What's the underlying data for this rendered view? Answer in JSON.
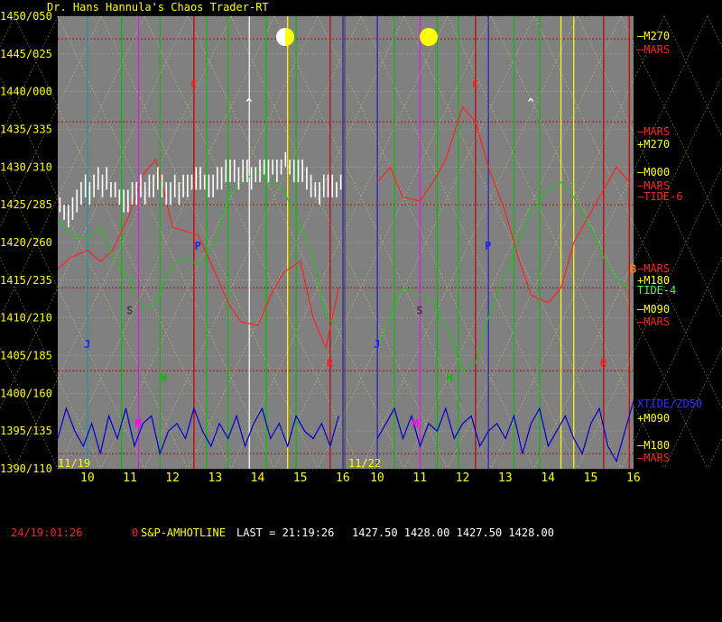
{
  "window": {
    "title": "Dr. Hans Hannula's Chaos Trader-RT"
  },
  "chart_data": {
    "type": "line",
    "price_axis": {
      "labels": [
        "1450/050",
        "1445/025",
        "1440/000",
        "1435/335",
        "1430/310",
        "1425/285",
        "1420/260",
        "1415/235",
        "1410/210",
        "1405/185",
        "1400/160",
        "1395/135",
        "1390/110"
      ],
      "ylim": [
        1390,
        1450
      ]
    },
    "time_axis": {
      "hour_labels": [
        "10",
        "11",
        "12",
        "13",
        "14",
        "15",
        "16",
        "10",
        "11",
        "12",
        "13",
        "14",
        "15",
        "16"
      ],
      "date_labels": [
        "11/19",
        "11/22"
      ]
    },
    "right_labels": [
      {
        "text": "—M270",
        "color": "#ffff00"
      },
      {
        "text": "—MARS",
        "color": "#ff2020"
      },
      {
        "text": "—MARS",
        "color": "#ff2020"
      },
      {
        "text": "+M270",
        "color": "#ffff00"
      },
      {
        "text": "—M000",
        "color": "#ffff00"
      },
      {
        "text": "—MARS",
        "color": "#ff2020"
      },
      {
        "text": "—TIDE-6",
        "color": "#ff2020"
      },
      {
        "text": "—MARS",
        "color": "#ff2020"
      },
      {
        "text": "+M180",
        "color": "#ffff00"
      },
      {
        "text": "TIDE-4",
        "color": "#40ff40"
      },
      {
        "text": "—M090",
        "color": "#ffff00"
      },
      {
        "text": "—MARS",
        "color": "#ff2020"
      },
      {
        "text": "XTIDE/ZD50",
        "color": "#3030ff"
      },
      {
        "text": "+M090",
        "color": "#ffff00"
      },
      {
        "text": "—M180",
        "color": "#ffff00"
      },
      {
        "text": "—MARS",
        "color": "#ff2020"
      }
    ],
    "planet_markers": [
      {
        "text": "C",
        "color": "#ff2020",
        "day": 1
      },
      {
        "text": "C",
        "color": "#ff2020",
        "day": 2
      },
      {
        "text": "P",
        "color": "#2020ff",
        "day": 1
      },
      {
        "text": "P",
        "color": "#2020ff",
        "day": 2
      },
      {
        "text": "S",
        "color": "#404040",
        "day": 1
      },
      {
        "text": "S",
        "color": "#404040",
        "day": 2
      },
      {
        "text": "J",
        "color": "#2020ff",
        "day": 1
      },
      {
        "text": "J",
        "color": "#2020ff",
        "day": 2
      },
      {
        "text": "R",
        "color": "#ff2020",
        "day": 1
      },
      {
        "text": "R",
        "color": "#ff2020",
        "day": 2
      },
      {
        "text": "H",
        "color": "#00c000",
        "day": 1
      },
      {
        "text": "H",
        "color": "#00c000",
        "day": 2
      },
      {
        "text": "M",
        "color": "#ff00ff",
        "day": 1
      },
      {
        "text": "M",
        "color": "#ff00ff",
        "day": 2
      },
      {
        "text": "^",
        "color": "#ffffff",
        "day": 1
      },
      {
        "text": "^",
        "color": "#ffffff",
        "day": 2
      },
      {
        "text": "B",
        "color": "#ff8000",
        "day": 2
      }
    ],
    "moon_icons": [
      "half-moon",
      "full-moon"
    ],
    "series": [
      {
        "name": "TIDE-6",
        "color": "#ff2020",
        "x": [
          9.3,
          9.6,
          10.0,
          10.3,
          10.6,
          11.0,
          11.3,
          11.6,
          12.0,
          12.3,
          12.6,
          13.0,
          13.3,
          13.6,
          14.0,
          14.3,
          14.6,
          15.0,
          15.3,
          15.6,
          15.9,
          10.0,
          10.3,
          10.6,
          11.0,
          11.3,
          11.6,
          12.0,
          12.3,
          12.6,
          13.0,
          13.3,
          13.6,
          14.0,
          14.3,
          14.6,
          15.0,
          15.3,
          15.6,
          15.9
        ],
        "y": [
          1416.5,
          1418,
          1419,
          1417.5,
          1419,
          1424,
          1429,
          1431,
          1422,
          1421.5,
          1421,
          1416,
          1412,
          1409.5,
          1409,
          1413,
          1416,
          1417.5,
          1410,
          1406,
          1414,
          1428,
          1430,
          1426,
          1425.5,
          1428,
          1431,
          1438,
          1436,
          1430,
          1424,
          1418,
          1413,
          1412,
          1414,
          1420,
          1424,
          1427,
          1430,
          1428
        ]
      },
      {
        "name": "TIDE-4",
        "color": "#20c020",
        "x": [
          9.3,
          9.6,
          10.0,
          10.3,
          10.6,
          11.0,
          11.3,
          11.6,
          12.0,
          12.3,
          12.6,
          13.0,
          13.3,
          13.6,
          14.0,
          14.3,
          14.6,
          15.0,
          15.3,
          15.6,
          15.9,
          10.0,
          10.3,
          10.6,
          11.0,
          11.3,
          11.6,
          12.0,
          12.3,
          12.6,
          13.0,
          13.3,
          13.6,
          14.0,
          14.3,
          14.6,
          15.0,
          15.3,
          15.6,
          15.9
        ],
        "y": [
          1423,
          1421,
          1420.5,
          1422,
          1418,
          1415,
          1411,
          1412,
          1417,
          1418,
          1417,
          1420,
          1426,
          1428,
          1429.5,
          1428,
          1427,
          1422,
          1418,
          1410,
          1409,
          1406,
          1410,
          1414,
          1413,
          1412,
          1409,
          1403,
          1404,
          1410,
          1416,
          1420,
          1424,
          1427,
          1428,
          1426,
          1422,
          1418,
          1415,
          1414
        ]
      },
      {
        "name": "XTIDE/ZD50",
        "color": "#0000d0",
        "x": [
          9.3,
          9.5,
          9.7,
          9.9,
          10.1,
          10.3,
          10.5,
          10.7,
          10.9,
          11.1,
          11.3,
          11.5,
          11.7,
          11.9,
          12.1,
          12.3,
          12.5,
          12.7,
          12.9,
          13.1,
          13.3,
          13.5,
          13.7,
          13.9,
          14.1,
          14.3,
          14.5,
          14.7,
          14.9,
          15.1,
          15.3,
          15.5,
          15.7,
          15.9,
          10.0,
          10.2,
          10.4,
          10.6,
          10.8,
          11.0,
          11.2,
          11.4,
          11.6,
          11.8,
          12.0,
          12.2,
          12.4,
          12.6,
          12.8,
          13.0,
          13.2,
          13.4,
          13.6,
          13.8,
          14.0,
          14.2,
          14.4,
          14.6,
          14.8,
          15.0,
          15.2,
          15.4,
          15.6,
          15.8,
          16.0
        ],
        "y": [
          1394,
          1398,
          1395,
          1393,
          1396,
          1392,
          1397,
          1394,
          1398,
          1393,
          1396,
          1397,
          1392,
          1395,
          1396,
          1394,
          1398,
          1395,
          1393,
          1396,
          1394,
          1397,
          1393,
          1396,
          1398,
          1394,
          1396,
          1393,
          1397,
          1395,
          1394,
          1396,
          1393,
          1397,
          1394,
          1396,
          1398,
          1394,
          1397,
          1393,
          1396,
          1395,
          1398,
          1394,
          1396,
          1397,
          1393,
          1395,
          1396,
          1394,
          1397,
          1392,
          1396,
          1398,
          1393,
          1395,
          1397,
          1394,
          1392,
          1396,
          1398,
          1393,
          1391,
          1395,
          1399
        ]
      }
    ],
    "price_bars": {
      "color": "#ffffff",
      "x": [
        9.35,
        9.45,
        9.55,
        9.65,
        9.75,
        9.85,
        9.95,
        10.05,
        10.15,
        10.25,
        10.35,
        10.45,
        10.55,
        10.65,
        10.75,
        10.85,
        10.95,
        11.05,
        11.15,
        11.25,
        11.35,
        11.45,
        11.55,
        11.65,
        11.75,
        11.85,
        11.95,
        12.05,
        12.15,
        12.25,
        12.35,
        12.45,
        12.55,
        12.65,
        12.75,
        12.85,
        12.95,
        13.05,
        13.15,
        13.25,
        13.35,
        13.45,
        13.55,
        13.65,
        13.75,
        13.85,
        13.95,
        14.05,
        14.15,
        14.25,
        14.35,
        14.45,
        14.55,
        14.65,
        14.75,
        14.85,
        14.95,
        15.05,
        15.15,
        15.25,
        15.35,
        15.45,
        15.55,
        15.65,
        15.75,
        15.85,
        15.95
      ],
      "low": [
        1424,
        1423,
        1422,
        1423,
        1424,
        1425,
        1426,
        1425,
        1426,
        1427,
        1426,
        1427,
        1426,
        1426,
        1425,
        1424,
        1424,
        1425,
        1425,
        1426,
        1425,
        1426,
        1426,
        1427,
        1426,
        1425,
        1425,
        1426,
        1425,
        1426,
        1426,
        1427,
        1427,
        1427,
        1427,
        1426,
        1426,
        1427,
        1427,
        1428,
        1428,
        1428,
        1427,
        1428,
        1428,
        1427,
        1428,
        1428,
        1429,
        1428,
        1429,
        1428,
        1429,
        1430,
        1429,
        1428,
        1428,
        1428,
        1427,
        1426,
        1426,
        1425,
        1426,
        1426,
        1426,
        1426,
        1427
      ],
      "high": [
        1426,
        1425,
        1425,
        1426,
        1427,
        1428,
        1429,
        1428,
        1429,
        1430,
        1429,
        1430,
        1428,
        1428,
        1427,
        1427,
        1427,
        1428,
        1428,
        1429,
        1428,
        1429,
        1429,
        1430,
        1429,
        1428,
        1428,
        1429,
        1428,
        1429,
        1429,
        1429,
        1430,
        1430,
        1429,
        1429,
        1429,
        1430,
        1430,
        1431,
        1431,
        1431,
        1430,
        1431,
        1431,
        1430,
        1430,
        1431,
        1431,
        1431,
        1431,
        1431,
        1431,
        1432,
        1431,
        1431,
        1431,
        1431,
        1430,
        1429,
        1428,
        1428,
        1429,
        1429,
        1429,
        1428,
        1429
      ]
    }
  },
  "status": {
    "timestamp": "24/19:01:26",
    "zero": "0",
    "symbol": "S&P-AMHOTLINE",
    "last_label": "LAST = 21:19:26",
    "values": "1427.50 1428.00 1427.50 1428.00"
  }
}
